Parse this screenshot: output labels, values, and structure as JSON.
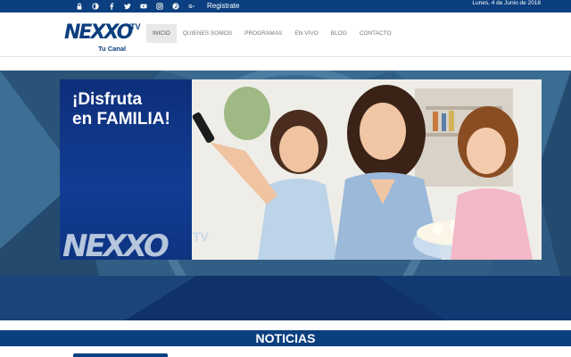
{
  "topbar": {
    "icons": [
      "lock-icon",
      "contrast-icon",
      "facebook-icon",
      "twitter-icon",
      "youtube-icon",
      "instagram-icon",
      "pinterest-icon",
      "google-plus-icon"
    ],
    "register_label": "Registrate",
    "date": "Lunes, 4 de Junio de 2018"
  },
  "header": {
    "logo_text": "NEXXO",
    "logo_tv": "TV",
    "logo_tagline": "Tu Canal",
    "nav": [
      {
        "label": "INICIO",
        "active": true
      },
      {
        "label": "QUIENES SOMOS",
        "active": false
      },
      {
        "label": "PROGRAMAS",
        "active": false
      },
      {
        "label": "EN VIVO",
        "active": false
      },
      {
        "label": "BLOG",
        "active": false
      },
      {
        "label": "CONTACTO",
        "active": false
      }
    ]
  },
  "hero": {
    "headline_line1": "¡Disfruta",
    "headline_line2": "en FAMILIA!",
    "watermark_text": "NEXXO",
    "watermark_tv": "TV"
  },
  "sections": {
    "noticias_title": "NOTICIAS"
  },
  "colors": {
    "brand_blue": "#0b3f7f",
    "panel_blue": "#123d94",
    "hero_bg": "#2f5f86"
  }
}
